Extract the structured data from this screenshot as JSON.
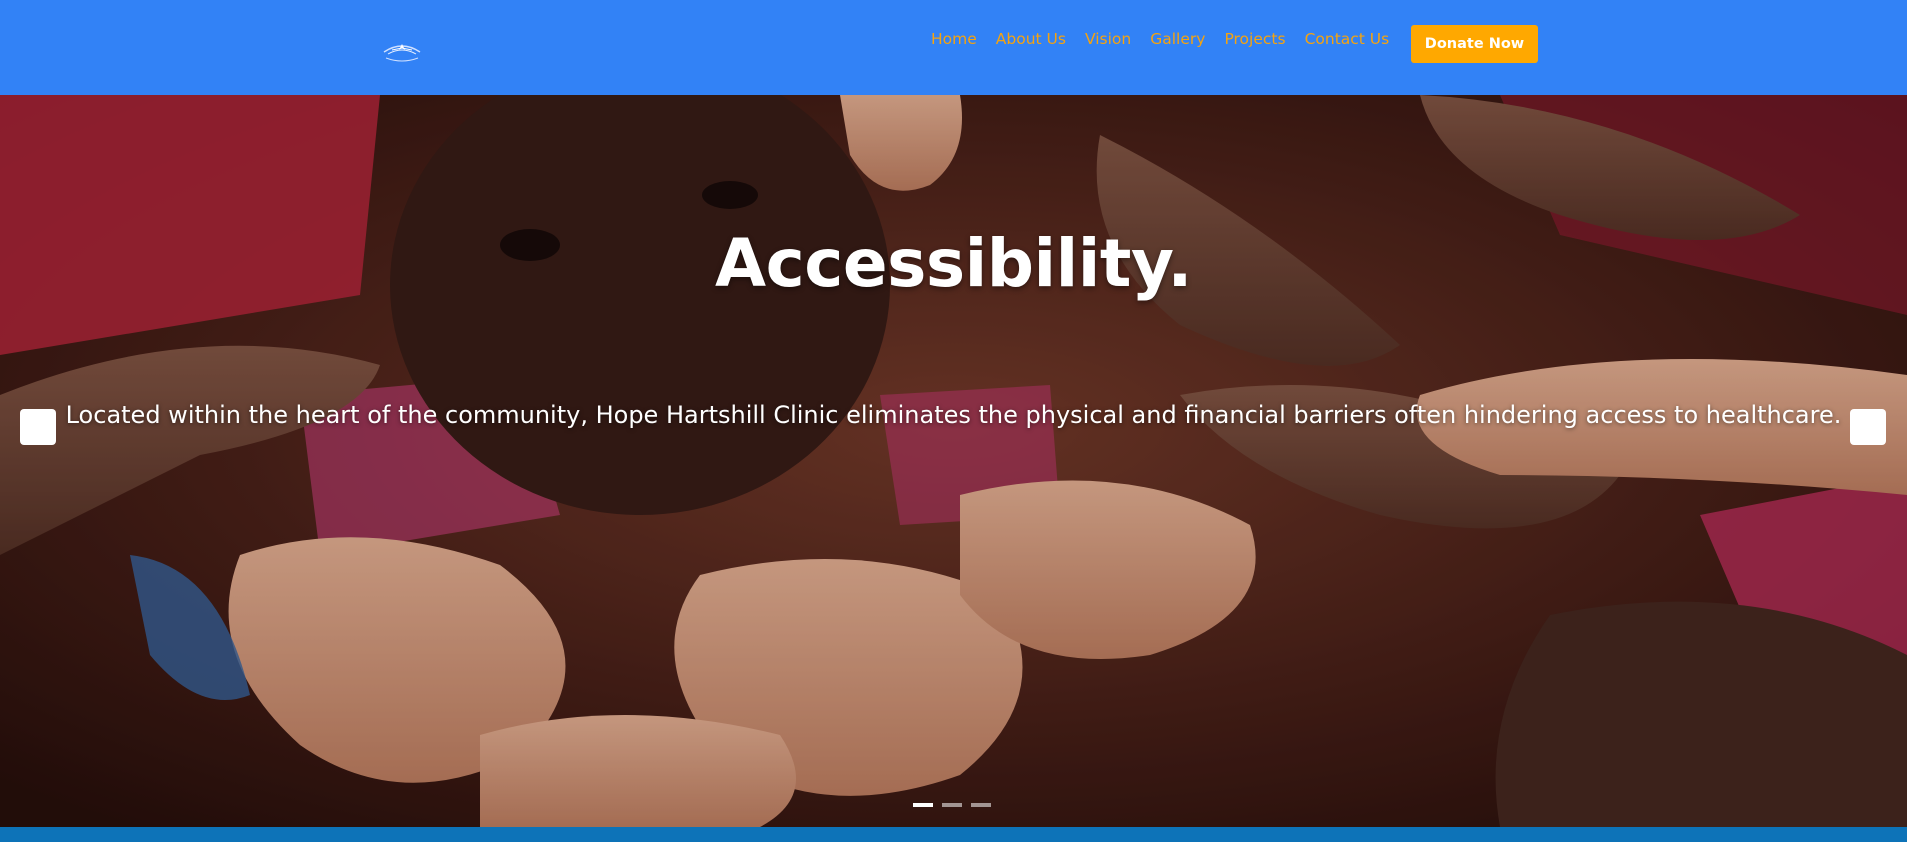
{
  "header": {
    "nav": [
      {
        "label": "Home"
      },
      {
        "label": "About Us"
      },
      {
        "label": "Vision"
      },
      {
        "label": "Gallery"
      },
      {
        "label": "Projects"
      },
      {
        "label": "Contact Us"
      }
    ],
    "donate_label": "Donate Now"
  },
  "hero": {
    "title": "Accessibility.",
    "text": "Located within the heart of the community, Hope Hartshill Clinic eliminates the physical and financial barriers often hindering access to healthcare.",
    "slide_count": 3,
    "active_slide": 1
  },
  "colors": {
    "header_bg": "#3282f6",
    "nav_text": "#f4a310",
    "donate_bg": "#ffa800",
    "bottom_bar": "#0d73b8"
  }
}
